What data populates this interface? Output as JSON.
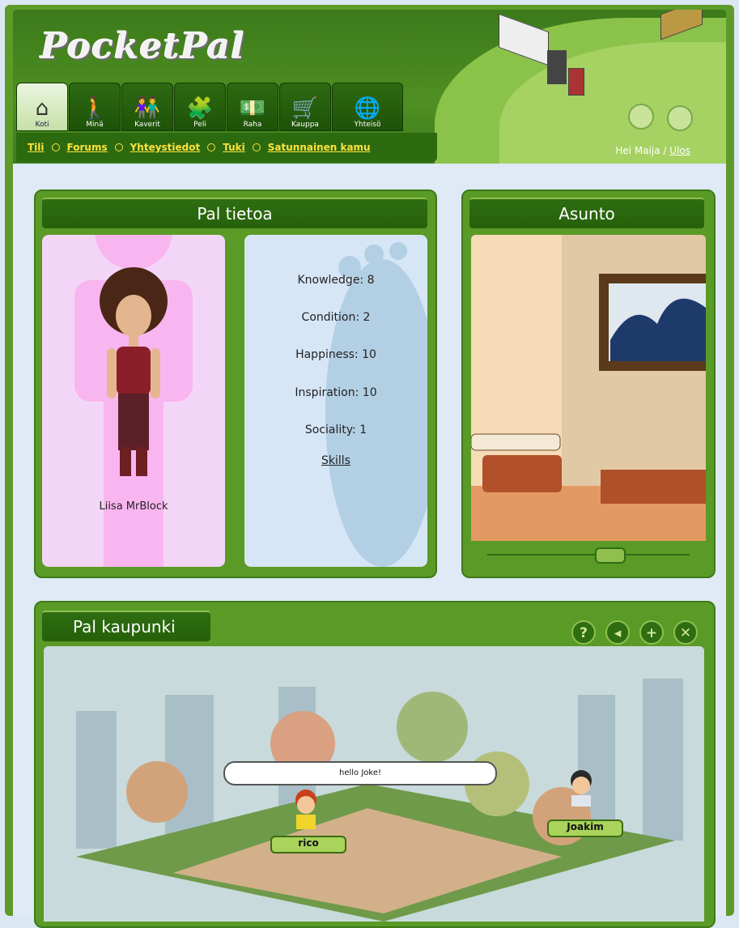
{
  "app": {
    "logo_text": "PocketPal"
  },
  "nav": {
    "tabs": [
      {
        "label": "Koti",
        "icon": "home-icon",
        "glyph": "⌂",
        "active": true
      },
      {
        "label": "Minä",
        "icon": "person-walking-icon",
        "glyph": "🚶"
      },
      {
        "label": "Kaverit",
        "icon": "friends-icon",
        "glyph": "👫"
      },
      {
        "label": "Peli",
        "icon": "puzzle-icon",
        "glyph": "🧩"
      },
      {
        "label": "Raha",
        "icon": "money-icon",
        "glyph": "💵"
      },
      {
        "label": "Kauppa",
        "icon": "shopping-cart-icon",
        "glyph": "🛒"
      },
      {
        "label": "Yhteisö",
        "icon": "globe-icon",
        "glyph": "🌐"
      }
    ],
    "sublinks": [
      "Tili",
      "Forums",
      "Yhteystiedot",
      "Tuki",
      "Satunnainen kamu"
    ],
    "greeting": "Hei Maija / ",
    "logout": "Ulos"
  },
  "pal_info": {
    "title": "Pal tietoa",
    "avatar_name": "Liisa MrBlock",
    "stats": [
      "Knowledge: 8",
      "Condition: 2",
      "Happiness: 10",
      "Inspiration: 10",
      "Sociality: 1"
    ],
    "skills_link": "Skills"
  },
  "asunto": {
    "title": "Asunto",
    "slider_value": 0.6
  },
  "city": {
    "title": "Pal kaupunki",
    "controls": [
      {
        "name": "help-icon",
        "glyph": "?"
      },
      {
        "name": "sound-icon",
        "glyph": "◂"
      },
      {
        "name": "zoom-in-icon",
        "glyph": "+"
      },
      {
        "name": "close-icon",
        "glyph": "✕"
      }
    ],
    "speech": "hello Joke!",
    "characters": [
      "rico",
      "Joakim"
    ]
  },
  "colors": {
    "header_green": "#3b7a1a",
    "link_yellow": "#ffe23a",
    "panel_green": "#5a9a26"
  }
}
